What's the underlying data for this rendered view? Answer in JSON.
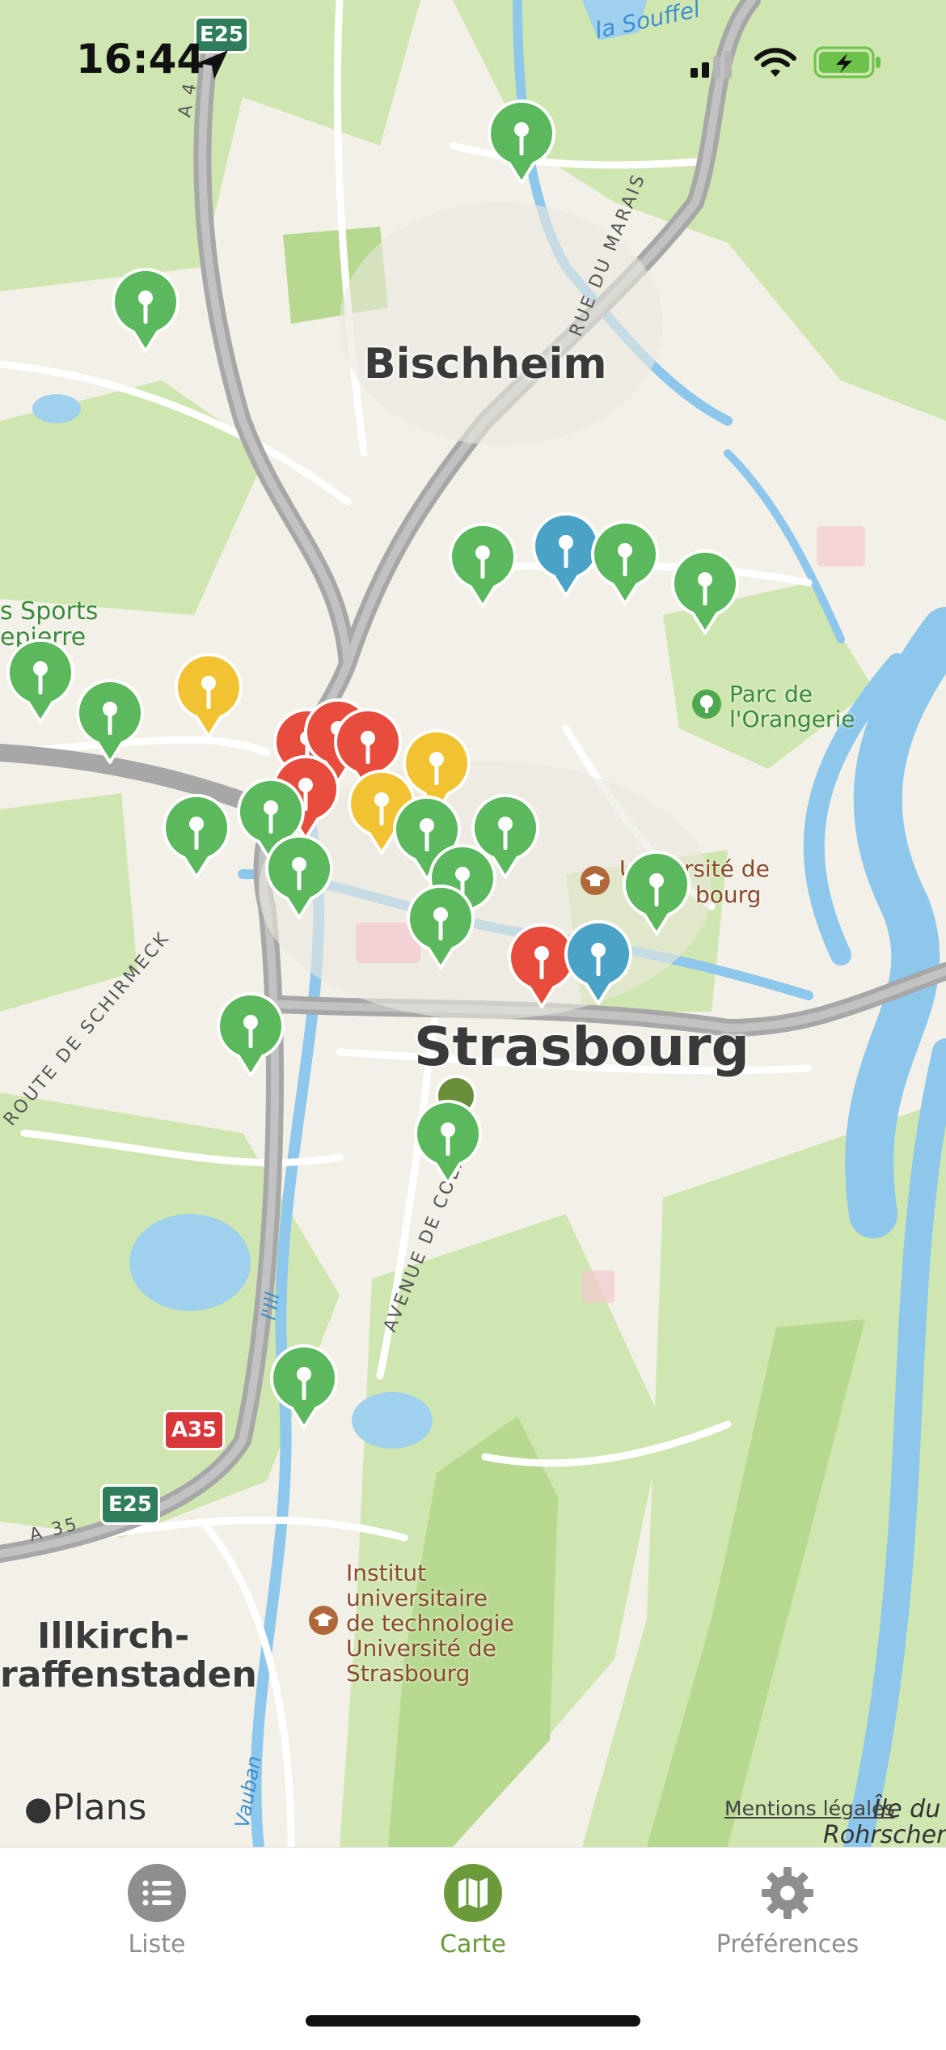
{
  "status_bar": {
    "time": "16:44"
  },
  "map": {
    "labels": {
      "city_strasbourg": "Strasbourg",
      "city_bischheim": "Bischheim",
      "city_illkirch_1": "Illkirch-",
      "city_illkirch_2": "raffenstaden",
      "park_orangerie_1": "Parc de",
      "park_orangerie_2": "l'Orangerie",
      "univ_1": "Université de",
      "univ_2": "bourg",
      "iut_1": "Institut",
      "iut_2": "universitaire",
      "iut_3": "de technologie",
      "iut_4": "Université de",
      "iut_5": "Strasbourg",
      "sports_1": "s Sports",
      "sports_2": "epierre",
      "rue_du_marais": "RUE DU MARAIS",
      "route_schirmeck": "ROUTE DE SCHIRMECK",
      "avenue_colmar": "AVENUE DE COLMAR",
      "la_souffel": "la Souffel",
      "ill": "l'Ill",
      "vauban": "Vauban",
      "ile_du_1": "Île du",
      "ile_du_2": "Rohrschen",
      "a4": "A 4",
      "a35_road": "A 35"
    },
    "shields": {
      "e25_top": "E25",
      "a35": "A35",
      "e25_bottom": "E25"
    },
    "attribution": {
      "brand": "Plans",
      "legal": "Mentions légales"
    },
    "pins": [
      {
        "color": "green"
      },
      {
        "color": "green"
      },
      {
        "color": "green"
      },
      {
        "color": "blue"
      },
      {
        "color": "green"
      },
      {
        "color": "green"
      },
      {
        "color": "green"
      },
      {
        "color": "green"
      },
      {
        "color": "yellow"
      },
      {
        "color": "red"
      },
      {
        "color": "red"
      },
      {
        "color": "red"
      },
      {
        "color": "red"
      },
      {
        "color": "yellow"
      },
      {
        "color": "yellow"
      },
      {
        "color": "green"
      },
      {
        "color": "green"
      },
      {
        "color": "green"
      },
      {
        "color": "green"
      },
      {
        "color": "green"
      },
      {
        "color": "green"
      },
      {
        "color": "green"
      },
      {
        "color": "green"
      },
      {
        "color": "red"
      },
      {
        "color": "blue"
      },
      {
        "color": "green"
      },
      {
        "color": "green"
      },
      {
        "color": "green"
      }
    ],
    "colors": {
      "green": "#5cb85c",
      "red": "#e74c3c",
      "yellow": "#f1c232",
      "blue": "#4aa3c6",
      "olive": "#6b8e3a"
    }
  },
  "tabbar": {
    "tabs": [
      {
        "label": "Liste",
        "icon": "list-icon",
        "selected": false
      },
      {
        "label": "Carte",
        "icon": "map-icon",
        "selected": true
      },
      {
        "label": "Préférences",
        "icon": "gear-icon",
        "selected": false
      }
    ],
    "accent": "#6a9a3a",
    "inactive": "#8e8e8e"
  }
}
